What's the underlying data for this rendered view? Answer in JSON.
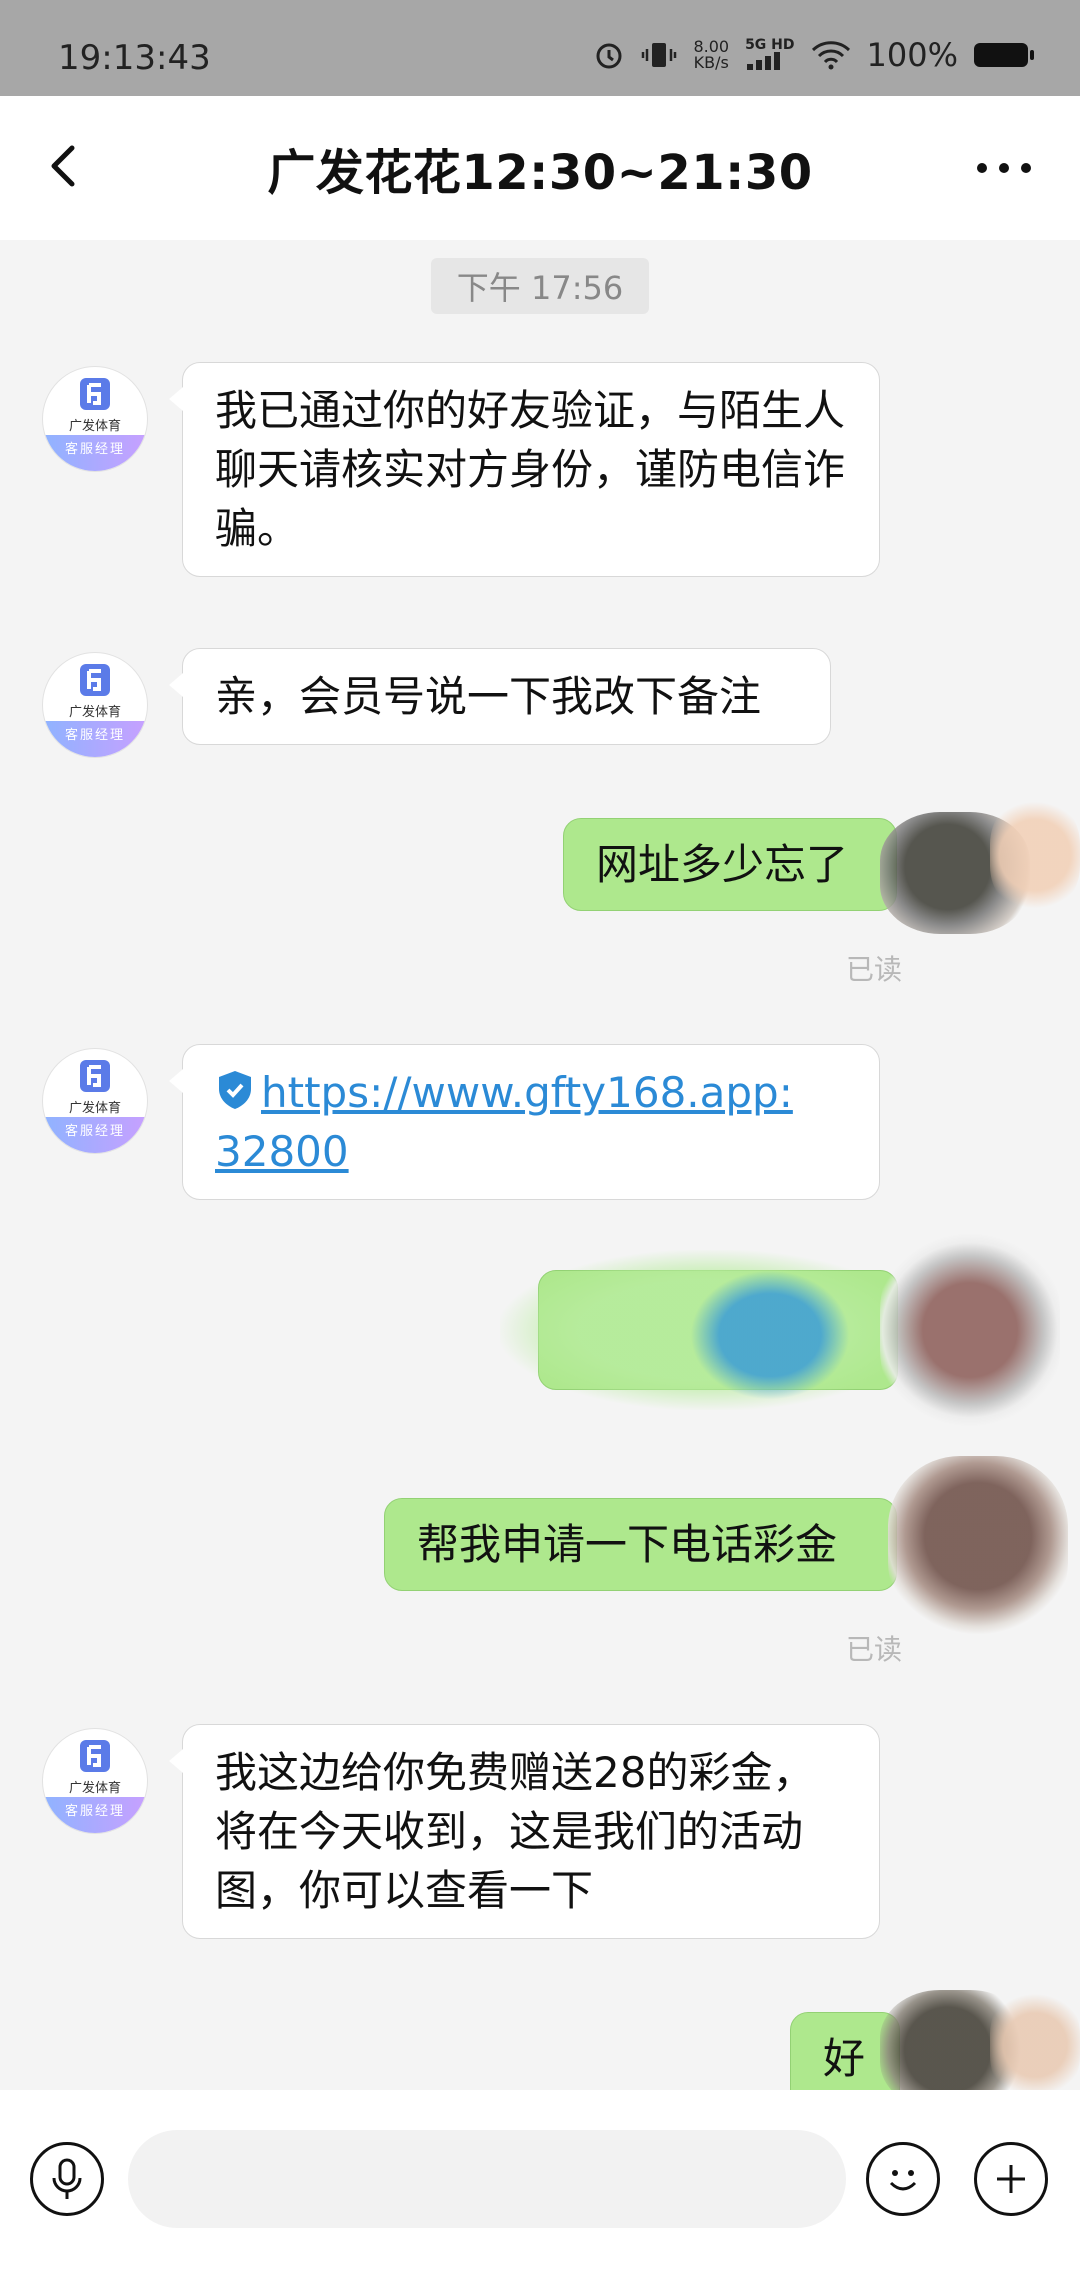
{
  "status_bar": {
    "time": "19:13:43",
    "net_speed_top": "8.00",
    "net_speed_bottom": "KB/s",
    "network": "5G HD",
    "battery": "100%"
  },
  "header": {
    "title": "广发花花12:30~21:30"
  },
  "chat": {
    "timestamp": "下午 17:56",
    "avatar": {
      "brand": "广发体育",
      "role": "客服经理"
    },
    "messages": [
      {
        "from": "agent",
        "text": "我已通过你的好友验证，与陌生人聊天请核实对方身份，谨防电信诈骗。"
      },
      {
        "from": "agent",
        "text": "亲，会员号说一下我改下备注"
      },
      {
        "from": "me",
        "text": "网址多少忘了",
        "status": "已读"
      },
      {
        "from": "agent",
        "link_line1": "https://www.gfty168.app:",
        "link_line2": "32800"
      },
      {
        "from": "me",
        "text": ""
      },
      {
        "from": "me",
        "text": "帮我申请一下电话彩金",
        "status": "已读"
      },
      {
        "from": "agent",
        "text": "我这边给你免费赠送28的彩金，将在今天收到，这是我们的活动图，你可以查看一下"
      },
      {
        "from": "me",
        "text": "好"
      }
    ]
  },
  "colors": {
    "outgoing_bubble": "#aee88d",
    "incoming_bubble": "#ffffff",
    "link": "#2b8ad6",
    "status_bar_bg": "#a7a7a7"
  },
  "icons": {
    "back": "chevron-left-icon",
    "more": "more-dots-icon",
    "shield": "shield-icon",
    "mic": "microphone-icon",
    "emoji": "emoji-icon",
    "plus": "plus-icon"
  }
}
